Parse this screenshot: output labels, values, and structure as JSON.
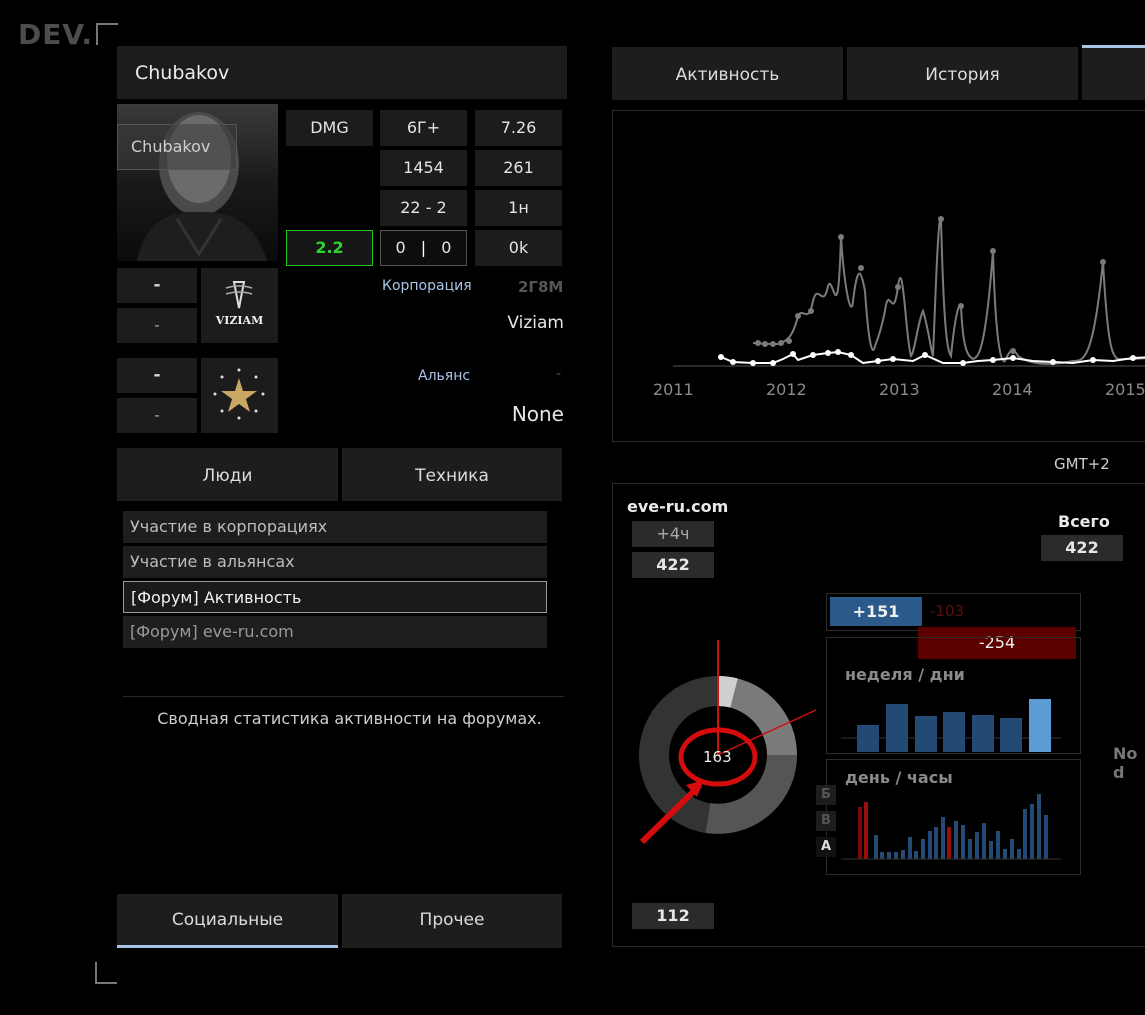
{
  "brand": {
    "logo_text": "DEV."
  },
  "profile": {
    "name": "Chubakov",
    "avatar_label": "Chubakov",
    "stats": {
      "dmg_label": "DMG",
      "c_6g": "6Г+",
      "c_726": "7.26",
      "c_1454": "1454",
      "c_261": "261",
      "c_22_2": "22 - 2",
      "c_1n": "1н",
      "green_value": "2.2",
      "left_zero": "0",
      "sep": "|",
      "right_zero": "0",
      "c_0k": "0k"
    },
    "corp_box": {
      "top": "-",
      "bottom": "-",
      "logo_text": "VIZIAM"
    },
    "alliance_box": {
      "top": "-",
      "bottom": "-"
    },
    "corporation_label": "Корпорация",
    "corporation_code": "2Г8М",
    "corporation_name": "Viziam",
    "alliance_label": "Альянс",
    "alliance_dash": "-",
    "alliance_name": "None"
  },
  "left_tabs": {
    "people": "Люди",
    "tech": "Техника"
  },
  "menu": [
    "Участие в корпорациях",
    "Участие в альянсах",
    "[Форум] Активность",
    "[Форум] eve-ru.com"
  ],
  "description": "Сводная статистика активности на форумах.",
  "bottom_tabs": {
    "social": "Социальные",
    "other": "Прочее"
  },
  "right_tabs": {
    "activity": "Активность",
    "history": "История"
  },
  "timeline": {
    "years": [
      "2011",
      "2012",
      "2013",
      "2014",
      "2015"
    ],
    "timezone": "GMT+2",
    "colors": {
      "gray_series": "#777777",
      "white_series": "#ffffff"
    }
  },
  "forum": {
    "site": "eve-ru.com",
    "offset": "+4ч",
    "site_total": "422",
    "total_label": "Всего",
    "total_value": "422",
    "delta_pos": "+151",
    "delta_neg_faded": "-103",
    "delta_neg": "-254",
    "donut_center": "163",
    "week_label": "неделя / дни",
    "day_label": "день / часы",
    "letters": [
      "Б",
      "В",
      "А"
    ],
    "bottom_value": "112",
    "no_data": "No d",
    "colors": {
      "blue": "#2b5fa0",
      "red": "#8a0b0b",
      "dark_red": "#5a0000",
      "accent_blue": "#5b9bd5"
    }
  }
}
